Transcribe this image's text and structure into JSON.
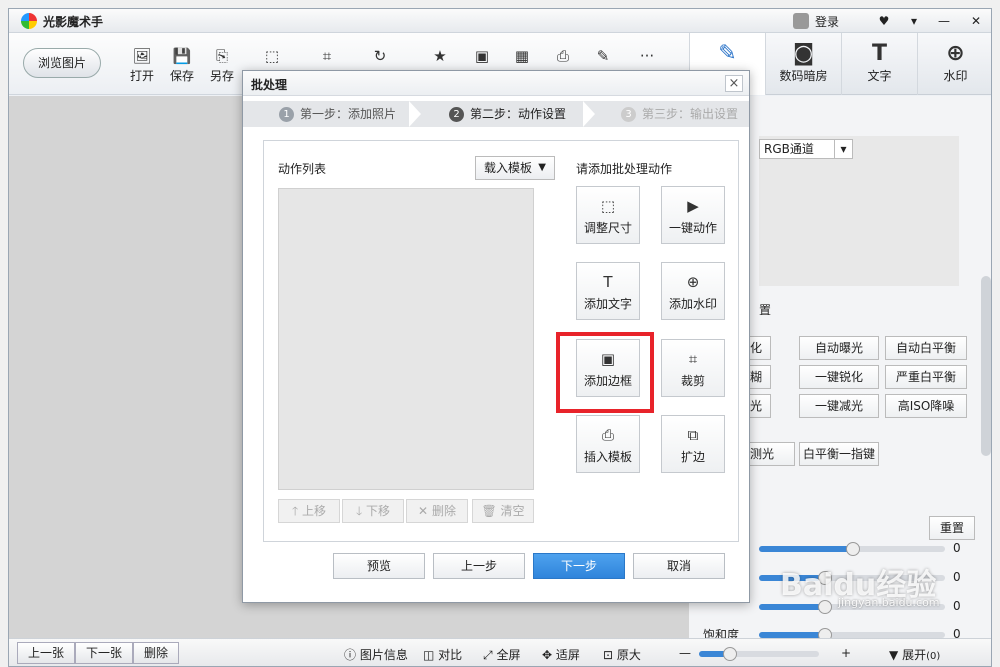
{
  "app": {
    "title": "光影魔术手",
    "login_label": "登录"
  },
  "toolbar": {
    "browse_label": "浏览图片",
    "tools": [
      {
        "label": "打开",
        "icon": "open-icon"
      },
      {
        "label": "保存",
        "icon": "save-icon"
      },
      {
        "label": "另存",
        "icon": "save-as-icon"
      }
    ]
  },
  "right_tabs": [
    {
      "label": "",
      "icon": "edit-icon"
    },
    {
      "label": "数码暗房",
      "icon": "camera-icon"
    },
    {
      "label": "文字",
      "icon": "text-icon"
    },
    {
      "label": "水印",
      "icon": "watermark-icon"
    }
  ],
  "right_panel": {
    "channel": "RGB通道",
    "section_char": "置",
    "buttons_row1": [
      "美化",
      "自动曝光",
      "自动白平衡"
    ],
    "buttons_row2": [
      "模糊",
      "一键锐化",
      "严重白平衡"
    ],
    "buttons_row3": [
      "补光",
      "一键减光",
      "高ISO降噪"
    ],
    "buttons_row4": [
      "测光",
      "白平衡一指键"
    ],
    "reset_label": "重置",
    "sliders": [
      {
        "label": "",
        "value": "0",
        "fraction": 0.5
      },
      {
        "label": "",
        "value": "0",
        "fraction": 0.35
      },
      {
        "label": "",
        "value": "0",
        "fraction": 0.35
      },
      {
        "label": "饱和度",
        "value": "0",
        "fraction": 0.35
      }
    ]
  },
  "dialog": {
    "title": "批处理",
    "close": "×",
    "steps": [
      {
        "num": "1",
        "label": "第一步：添加照片"
      },
      {
        "num": "2",
        "label": "第二步：动作设置"
      },
      {
        "num": "3",
        "label": "第三步：输出设置"
      }
    ],
    "action_list_label": "动作列表",
    "load_template_label": "载入模板",
    "add_actions_label": "请添加批处理动作",
    "list_buttons": [
      "上移",
      "下移",
      "删除",
      "清空"
    ],
    "actions": [
      {
        "label": "调整尺寸",
        "icon": "resize-icon"
      },
      {
        "label": "一键动作",
        "icon": "play-icon"
      },
      {
        "label": "添加文字",
        "icon": "text-add-icon"
      },
      {
        "label": "添加水印",
        "icon": "watermark-add-icon"
      },
      {
        "label": "添加边框",
        "icon": "border-add-icon"
      },
      {
        "label": "裁剪",
        "icon": "crop-icon"
      },
      {
        "label": "插入模板",
        "icon": "template-icon"
      },
      {
        "label": "扩边",
        "icon": "expand-icon"
      }
    ],
    "footer": [
      "预览",
      "上一步",
      "下一步",
      "取消"
    ]
  },
  "bottombar": {
    "prev": "上一张",
    "next": "下一张",
    "delete": "删除",
    "info": "图片信息",
    "compare": "对比",
    "fullscreen": "全屏",
    "fit": "适屏",
    "original": "原大",
    "expand": "展开",
    "expand_count": "(0)"
  },
  "watermark": {
    "logo": "Baidu经验",
    "url": "jingyan.baidu.com"
  }
}
